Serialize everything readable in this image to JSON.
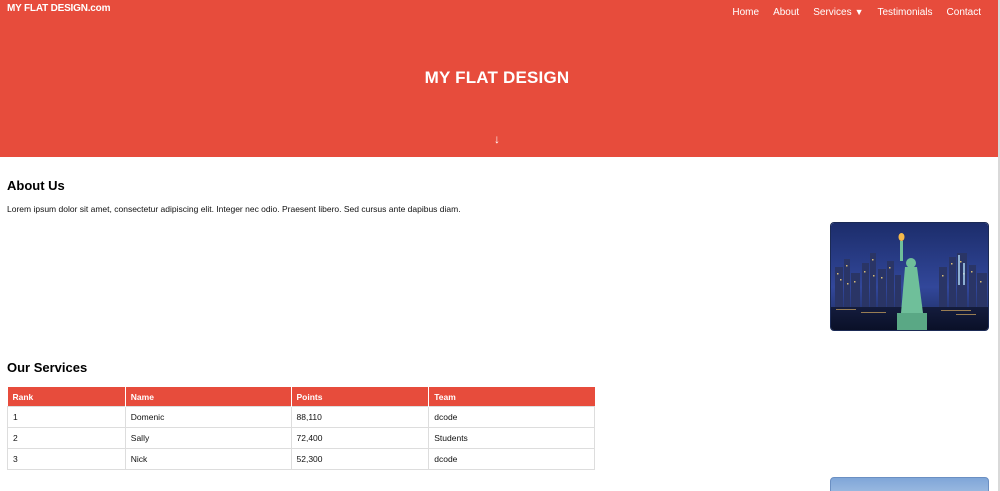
{
  "header": {
    "logo": "MY FLAT DESIGN.com",
    "nav": [
      {
        "label": "Home"
      },
      {
        "label": "About"
      },
      {
        "label": "Services"
      },
      {
        "label": "Testimonials"
      },
      {
        "label": "Contact"
      }
    ],
    "title": "MY FLAT DESIGN",
    "scroll_icon": "down-arrow-icon"
  },
  "about": {
    "title": "About Us",
    "text": "Lorem ipsum dolor sit amet, consectetur adipiscing elit. Integer nec odio. Praesent libero. Sed cursus ante dapibus diam."
  },
  "services": {
    "title": "Our Services",
    "columns": [
      "Rank",
      "Name",
      "Points",
      "Team"
    ],
    "rows": [
      [
        "1",
        "Domenic",
        "88,110",
        "dcode"
      ],
      [
        "2",
        "Sally",
        "72,400",
        "Students"
      ],
      [
        "3",
        "Nick",
        "52,300",
        "dcode"
      ]
    ]
  },
  "colors": {
    "accent": "#e74c3c",
    "text": "#000000",
    "background": "#ffffff"
  }
}
